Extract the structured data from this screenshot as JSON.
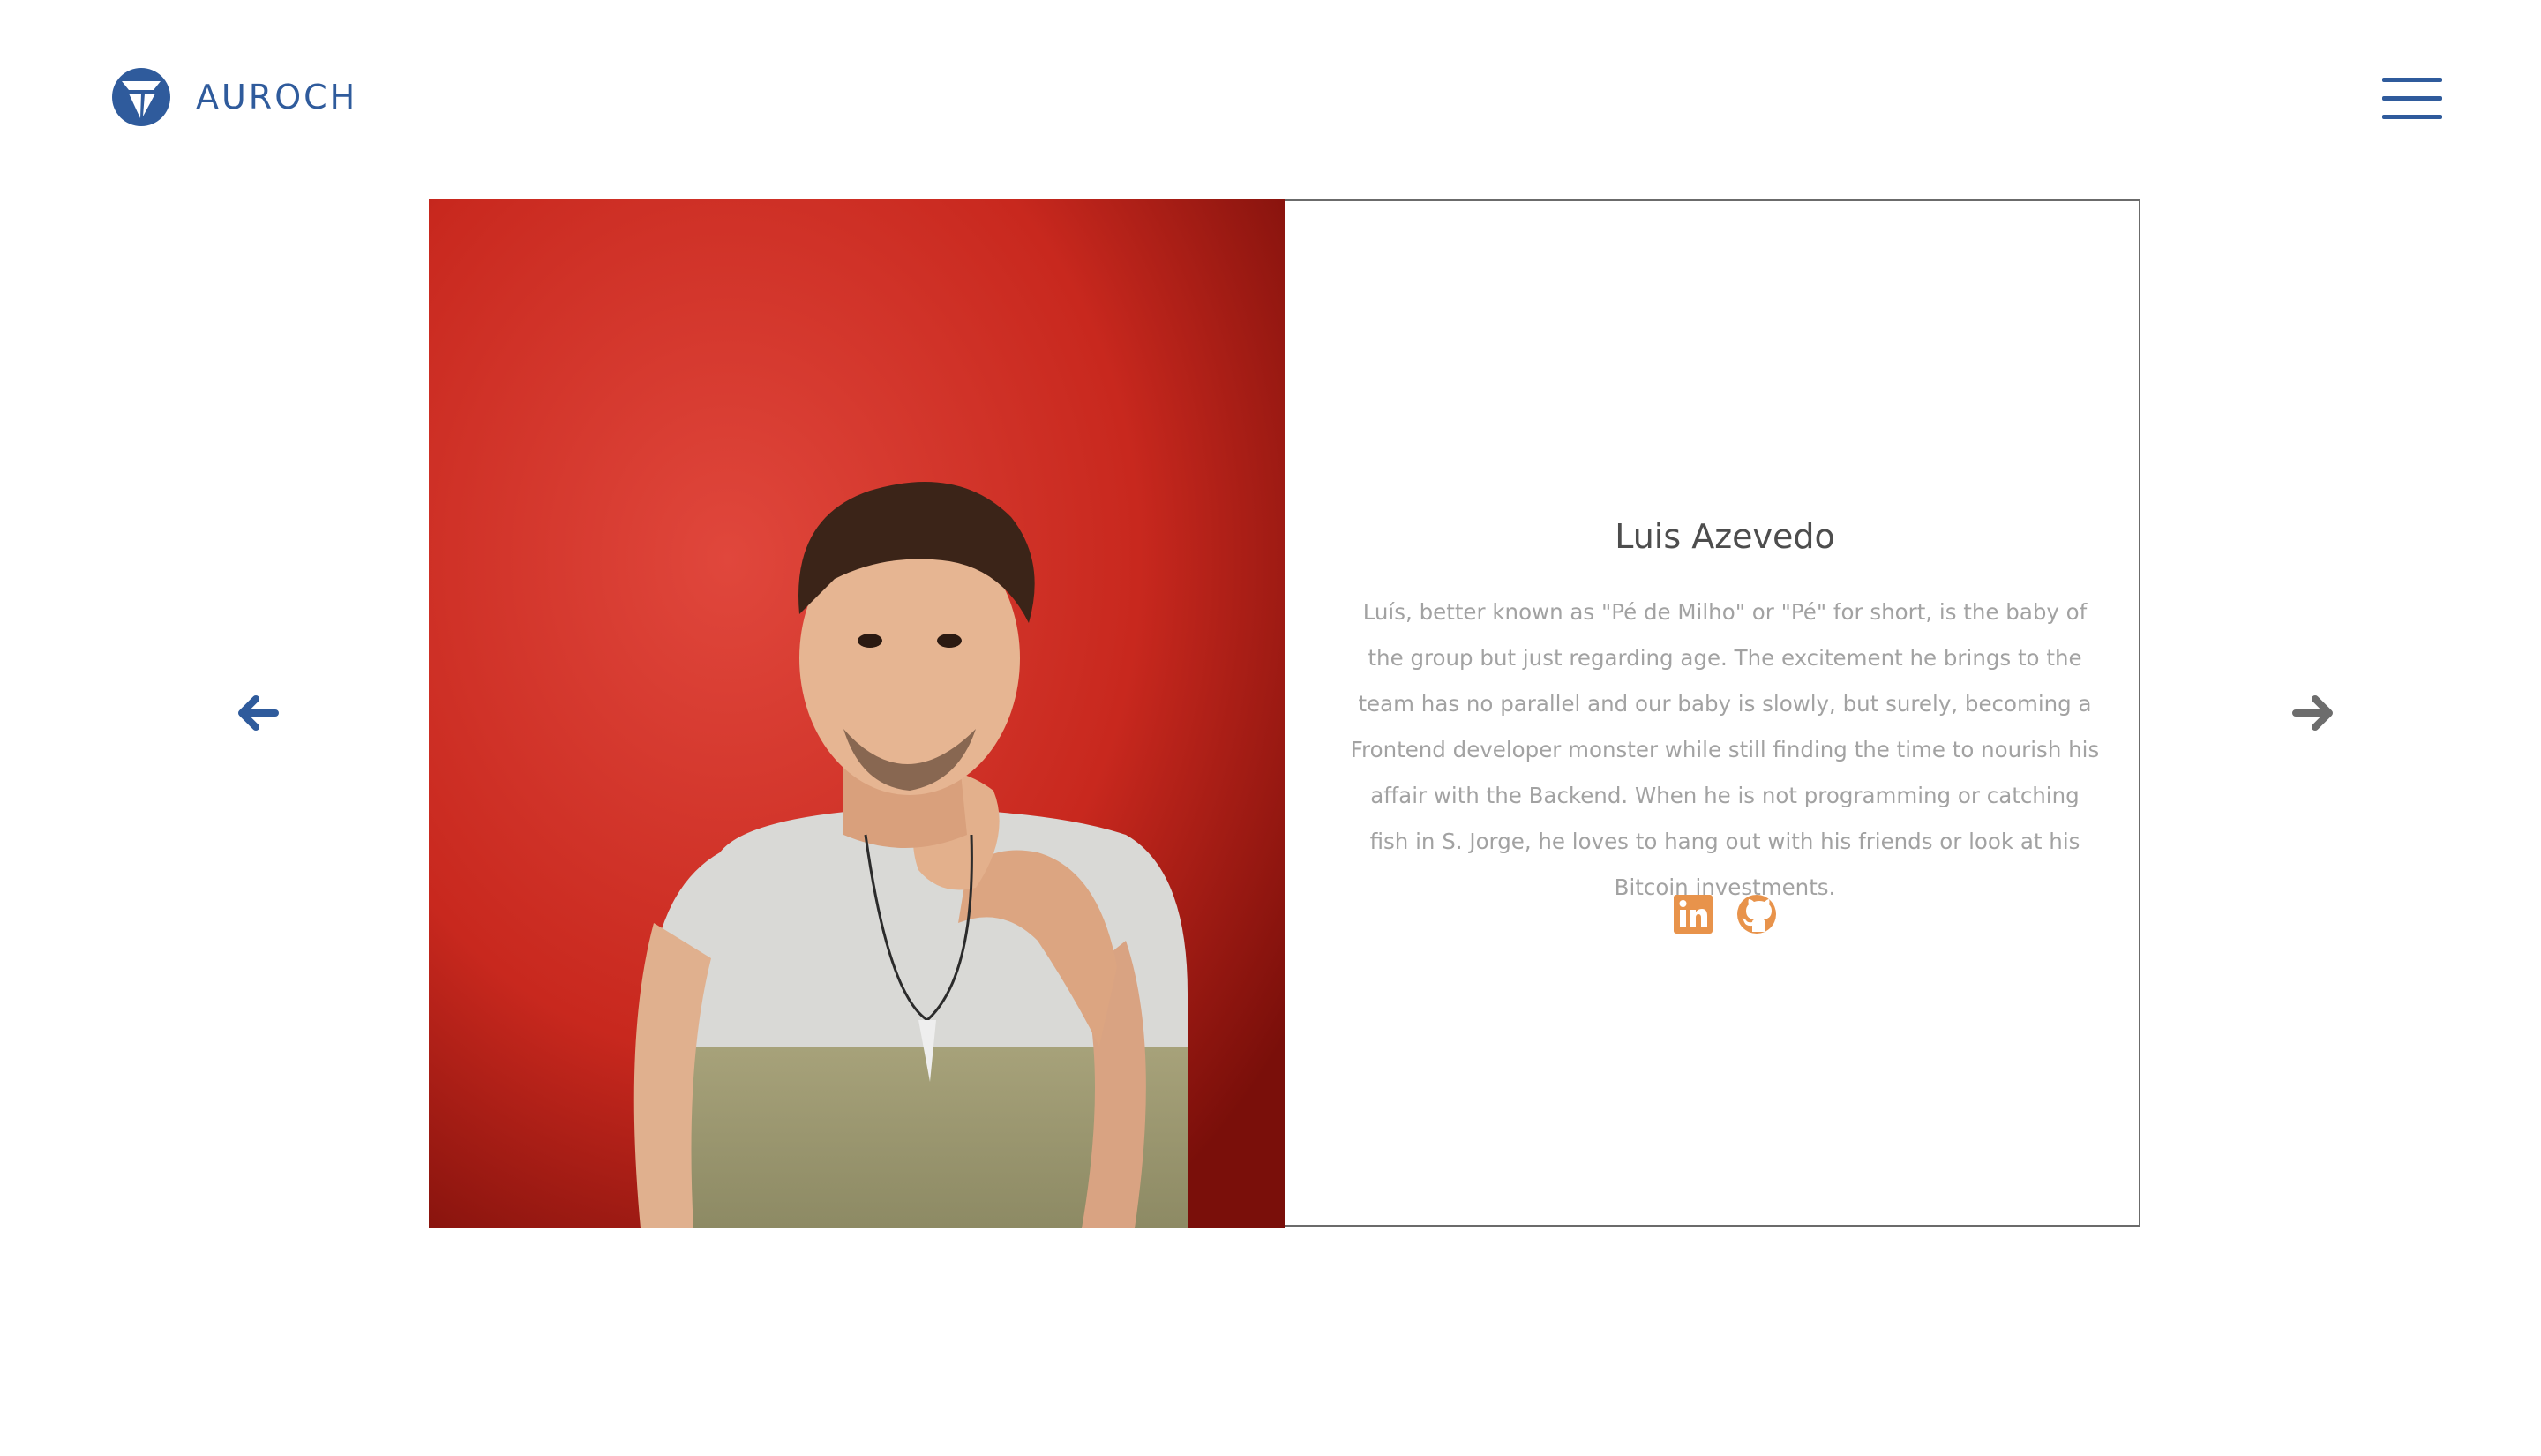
{
  "header": {
    "brand_name": "AUROCH",
    "logo_icon": "auroch-logo-icon",
    "menu_icon": "hamburger-menu-icon"
  },
  "carousel": {
    "prev_icon": "arrow-left-icon",
    "next_icon": "arrow-right-icon"
  },
  "member": {
    "name": "Luis Azevedo",
    "bio": "Luís, better known as \"Pé de Milho\" or \"Pé\" for short, is the baby of the group but just regarding age. The excitement he brings to the team has no parallel and our baby is slowly, but surely, becoming a Frontend developer monster while still finding the time to nourish his affair with the Backend. When he is not programming or catching fish in S. Jorge, he loves to hang out with his friends or look at his Bitcoin investments.",
    "photo": "team-member-portrait",
    "socials": [
      {
        "icon": "linkedin-icon"
      },
      {
        "icon": "github-icon"
      }
    ]
  },
  "colors": {
    "brand_blue": "#2f5b9c",
    "social_orange": "#e8934b",
    "name_text": "#4d4d4d",
    "bio_text": "#a2a2a2",
    "next_arrow": "#6d6d6d",
    "photo_background": "#c8281e"
  }
}
